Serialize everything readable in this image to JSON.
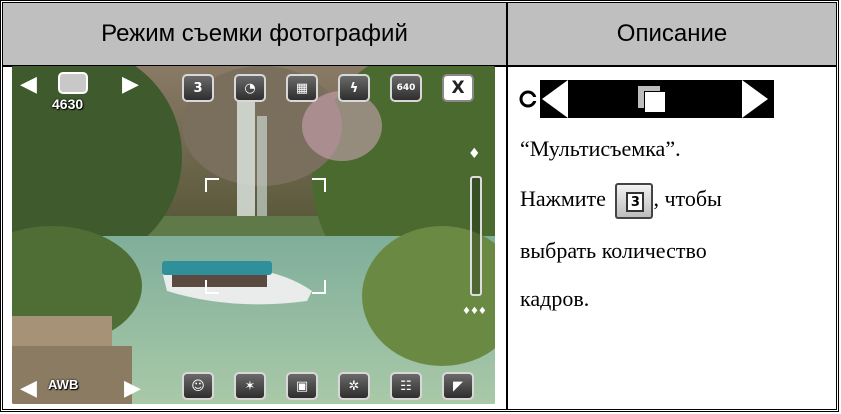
{
  "table": {
    "header_left": "Режим съемки фотографий",
    "header_right": "Описание"
  },
  "camera": {
    "shots_remaining": "4630",
    "wb_label": "AWB",
    "top_icons": [
      "burst-count-icon",
      "self-timer-icon",
      "date-stamp-icon",
      "flash-off-icon",
      "resolution-icon",
      "close-icon"
    ],
    "resolution_label": "640",
    "burst_label": "3",
    "close_label": "X",
    "bottom_icons": [
      "face-detect-icon",
      "effects-icon",
      "capture-mode-icon",
      "settings-icon",
      "grid-icon",
      "collapse-icon"
    ]
  },
  "description": {
    "line1": "“Мультисъемка”.",
    "line2_prefix": "Нажмите",
    "button_label": "3",
    "line2_suffix": ", чтобы",
    "line3": "выбрать количество",
    "line4": "кадров."
  }
}
